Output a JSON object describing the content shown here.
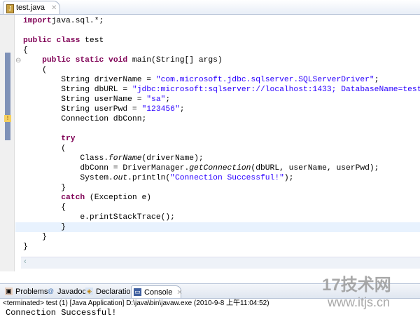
{
  "editor_tab": {
    "title": "test.java"
  },
  "code": [
    [
      [
        "kw",
        "import"
      ],
      [
        "",
        "java.sql.*;"
      ]
    ],
    [],
    [
      [
        "kw",
        "public class"
      ],
      [
        "",
        " test"
      ]
    ],
    [
      [
        "",
        "{"
      ]
    ],
    [
      [
        "",
        "    "
      ],
      [
        "kw",
        "public static void"
      ],
      [
        "",
        " main(String[] args)"
      ]
    ],
    [
      [
        "",
        "    ("
      ]
    ],
    [
      [
        "",
        "        String driverName = "
      ],
      [
        "str",
        "\"com.microsoft.jdbc.sqlserver.SQLServerDriver\""
      ],
      [
        "",
        ";"
      ]
    ],
    [
      [
        "",
        "        String dbURL = "
      ],
      [
        "str",
        "\"jdbc:microsoft:sqlserver://localhost:1433; DatabaseName=test\""
      ],
      [
        "",
        ";"
      ]
    ],
    [
      [
        "",
        "        String userName = "
      ],
      [
        "str",
        "\"sa\""
      ],
      [
        "",
        ";"
      ]
    ],
    [
      [
        "",
        "        String userPwd = "
      ],
      [
        "str",
        "\"123456\""
      ],
      [
        "",
        ";"
      ]
    ],
    [
      [
        "",
        "        Connection dbConn;"
      ]
    ],
    [],
    [
      [
        "",
        "        "
      ],
      [
        "kw",
        "try"
      ]
    ],
    [
      [
        "",
        "        ("
      ]
    ],
    [
      [
        "",
        "            Class."
      ],
      [
        "it",
        "forName"
      ],
      [
        "",
        "(driverName);"
      ]
    ],
    [
      [
        "",
        "            dbConn = DriverManager."
      ],
      [
        "it",
        "getConnection"
      ],
      [
        "",
        "(dbURL, userName, userPwd);"
      ]
    ],
    [
      [
        "",
        "            System."
      ],
      [
        "it",
        "out"
      ],
      [
        "",
        ".println("
      ],
      [
        "str",
        "\"Connection Successful!\""
      ],
      [
        "",
        ");"
      ]
    ],
    [
      [
        "",
        "        }"
      ]
    ],
    [
      [
        "",
        "        "
      ],
      [
        "kw",
        "catch"
      ],
      [
        "",
        " (Exception e)"
      ]
    ],
    [
      [
        "",
        "        {"
      ]
    ],
    [
      [
        "",
        "            e.printStackTrace();"
      ]
    ],
    [
      [
        "",
        "        }"
      ]
    ],
    [
      [
        "",
        "    }"
      ]
    ],
    [
      [
        "",
        "}"
      ]
    ]
  ],
  "bottom_tabs": [
    {
      "label": "Problems",
      "icon": "problems-icon"
    },
    {
      "label": "Javadoc",
      "icon": "at-icon"
    },
    {
      "label": "Declaration",
      "icon": "declaration-icon"
    },
    {
      "label": "Console",
      "icon": "console-icon",
      "active": true
    }
  ],
  "console": {
    "status": "<terminated> test (1) [Java Application] D:\\java\\bin\\javaw.exe (2010-9-8 上午11:04:52)",
    "output": "Connection Successful!"
  },
  "watermark": {
    "logo": "17技术网",
    "url": "www.itjs.cn"
  }
}
